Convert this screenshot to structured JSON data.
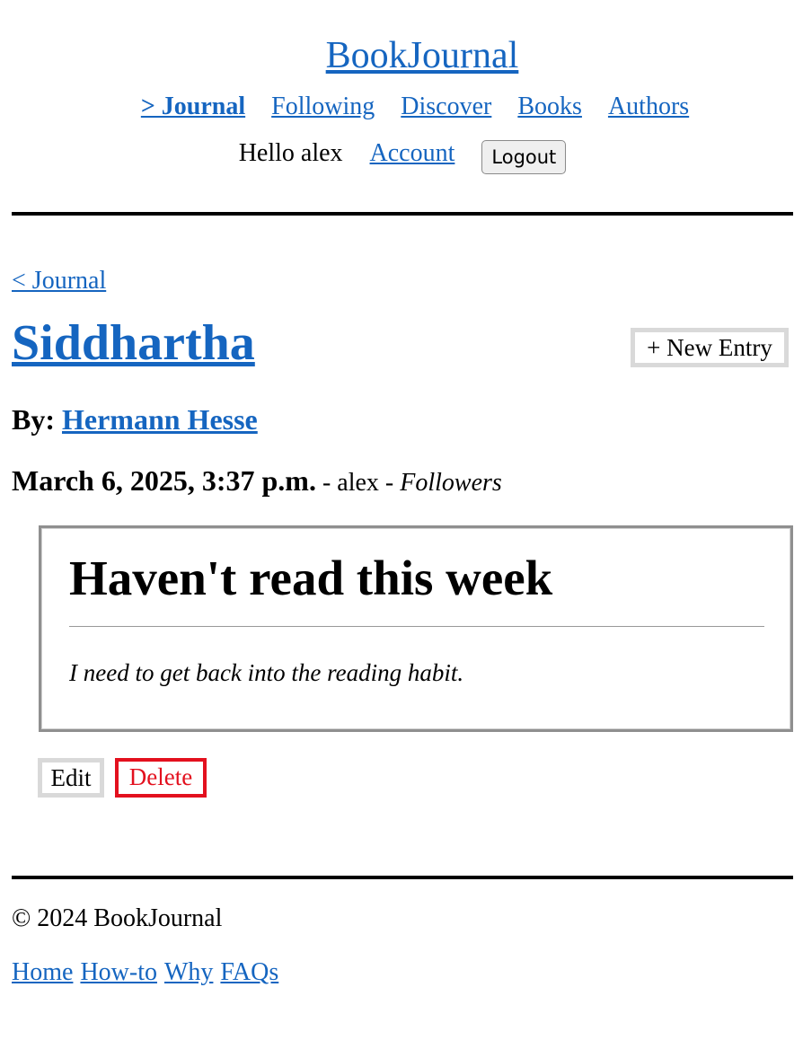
{
  "site": {
    "title": "BookJournal"
  },
  "nav": {
    "items": [
      {
        "label": "> Journal",
        "active": true
      },
      {
        "label": "Following",
        "active": false
      },
      {
        "label": "Discover",
        "active": false
      },
      {
        "label": "Books",
        "active": false
      },
      {
        "label": "Authors",
        "active": false
      }
    ]
  },
  "user_nav": {
    "greeting": "Hello alex",
    "account_label": "Account",
    "logout_label": "Logout"
  },
  "page": {
    "back_label": "< Journal",
    "book_title": "Siddhartha",
    "new_entry_label": "+ New Entry",
    "by_label": "By:",
    "author": "Hermann Hesse"
  },
  "entry": {
    "date": "March 6, 2025, 3:37 p.m.",
    "separator1": " - ",
    "user": "alex",
    "separator2": " - ",
    "visibility": "Followers",
    "heading": "Haven't read this week",
    "body": "I need to get back into the reading habit.",
    "edit_label": "Edit",
    "delete_label": "Delete"
  },
  "footer": {
    "copyright": "© 2024 BookJournal",
    "links": [
      {
        "label": "Home"
      },
      {
        "label": "How-to"
      },
      {
        "label": "Why"
      },
      {
        "label": "FAQs"
      }
    ]
  },
  "colors": {
    "link": "#1565c0",
    "danger": "#e3101e",
    "button_border": "#d9d9d9"
  }
}
